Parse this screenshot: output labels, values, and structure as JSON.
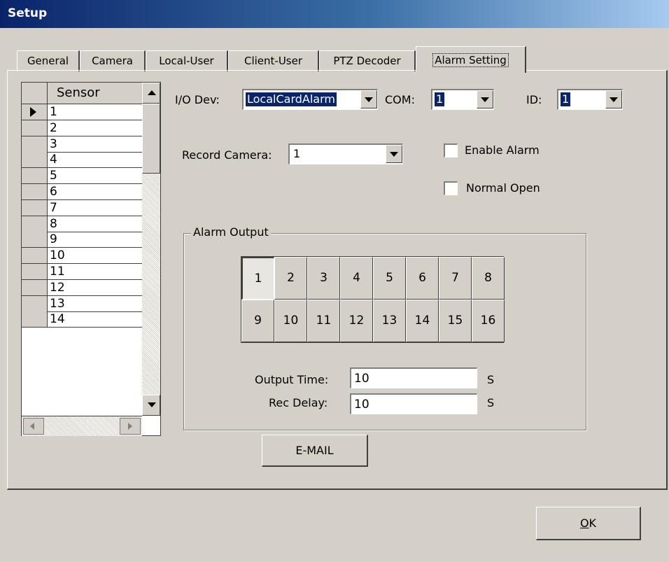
{
  "window": {
    "title": "Setup"
  },
  "tabs": [
    {
      "label": "General"
    },
    {
      "label": "Camera"
    },
    {
      "label": "Local-User"
    },
    {
      "label": "Client-User"
    },
    {
      "label": "PTZ Decoder"
    },
    {
      "label": "Alarm Setting",
      "active": true
    }
  ],
  "sensor_grid": {
    "header": "Sensor",
    "rows": [
      "1",
      "2",
      "3",
      "4",
      "5",
      "6",
      "7",
      "8",
      "9",
      "10",
      "11",
      "12",
      "13",
      "14"
    ],
    "selected_index": 0
  },
  "io": {
    "io_dev_label": "I/O Dev:",
    "io_dev_value": "LocalCardAlarm",
    "com_label": "COM:",
    "com_value": "1",
    "id_label": "ID:",
    "id_value": "1"
  },
  "record": {
    "label": "Record Camera:",
    "value": "1"
  },
  "checks": {
    "enable_alarm": "Enable Alarm",
    "normal_open": "Normal Open"
  },
  "alarm_output": {
    "legend": "Alarm Output",
    "buttons": [
      "1",
      "2",
      "3",
      "4",
      "5",
      "6",
      "7",
      "8",
      "9",
      "10",
      "11",
      "12",
      "13",
      "14",
      "15",
      "16"
    ],
    "pressed": "1",
    "output_time_label": "Output Time:",
    "output_time_value": "10",
    "output_time_unit": "S",
    "rec_delay_label": "Rec Delay:",
    "rec_delay_value": "10",
    "rec_delay_unit": "S"
  },
  "buttons": {
    "email": "E-MAIL",
    "ok_mnemonic": "O",
    "ok_rest": "K"
  },
  "colors": {
    "face": "#d4d0c8",
    "title_start": "#0a246a",
    "highlight": "#0a246a"
  }
}
